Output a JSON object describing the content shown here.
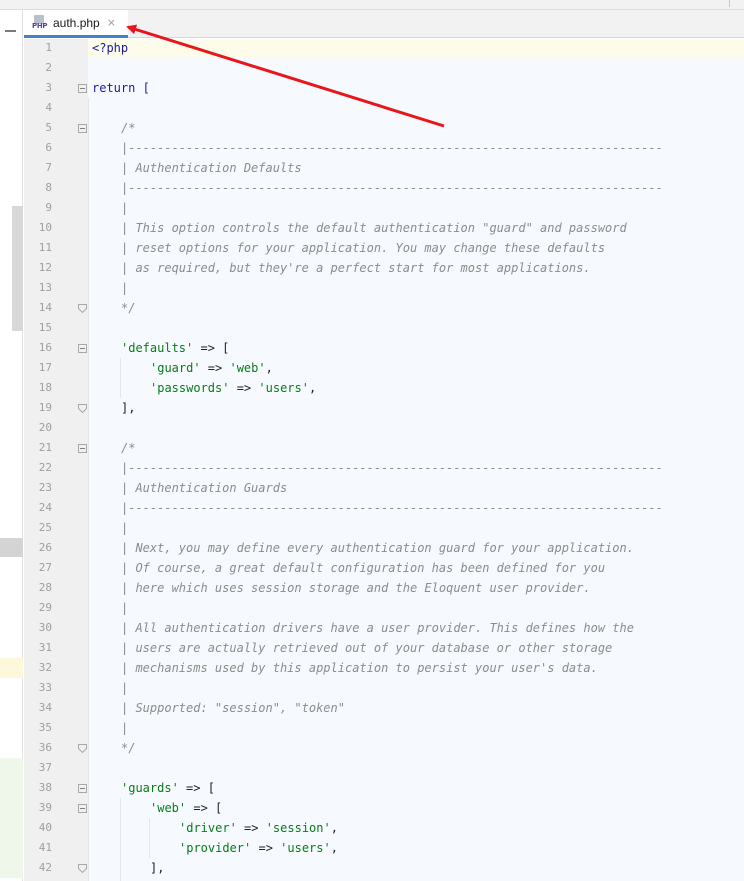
{
  "tab": {
    "filename": "auth.php",
    "icon_label": "PHP",
    "close_glyph": "×",
    "accent": "#4083c9"
  },
  "colors": {
    "keyword": "#1a1aa6",
    "comment": "#8c8c8c",
    "string": "#067d17",
    "annotation_arrow": "#e8161b"
  },
  "code_lines": [
    {
      "n": "1",
      "text": "<?php",
      "kind": "kw",
      "indent": 0,
      "fold": null
    },
    {
      "n": "2",
      "text": "",
      "kind": "plain",
      "indent": 0,
      "fold": null
    },
    {
      "n": "3",
      "text": "return [",
      "kind": "kw",
      "indent": 0,
      "fold": "open"
    },
    {
      "n": "4",
      "text": "",
      "kind": "plain",
      "indent": 0,
      "fold": null
    },
    {
      "n": "5",
      "text": "/*",
      "kind": "com",
      "indent": 1,
      "fold": "open"
    },
    {
      "n": "6",
      "text": "|--------------------------------------------------------------------------",
      "kind": "com",
      "indent": 1,
      "fold": null
    },
    {
      "n": "7",
      "text": "| Authentication Defaults",
      "kind": "com",
      "indent": 1,
      "fold": null
    },
    {
      "n": "8",
      "text": "|--------------------------------------------------------------------------",
      "kind": "com",
      "indent": 1,
      "fold": null
    },
    {
      "n": "9",
      "text": "|",
      "kind": "com",
      "indent": 1,
      "fold": null
    },
    {
      "n": "10",
      "text": "| This option controls the default authentication \"guard\" and password",
      "kind": "com",
      "indent": 1,
      "fold": null
    },
    {
      "n": "11",
      "text": "| reset options for your application. You may change these defaults",
      "kind": "com",
      "indent": 1,
      "fold": null
    },
    {
      "n": "12",
      "text": "| as required, but they're a perfect start for most applications.",
      "kind": "com",
      "indent": 1,
      "fold": null
    },
    {
      "n": "13",
      "text": "|",
      "kind": "com",
      "indent": 1,
      "fold": null
    },
    {
      "n": "14",
      "text": "*/",
      "kind": "com",
      "indent": 1,
      "fold": "close"
    },
    {
      "n": "15",
      "text": "",
      "kind": "plain",
      "indent": 0,
      "fold": null
    },
    {
      "n": "16",
      "text": "'defaults' => [",
      "kind": "arr",
      "indent": 1,
      "fold": "open",
      "key": "'defaults'",
      "rest": " => ["
    },
    {
      "n": "17",
      "text": "'guard' => 'web',",
      "kind": "kv",
      "indent": 2,
      "fold": null,
      "key": "'guard'",
      "val": "'web'"
    },
    {
      "n": "18",
      "text": "'passwords' => 'users',",
      "kind": "kv",
      "indent": 2,
      "fold": null,
      "key": "'passwords'",
      "val": "'users'"
    },
    {
      "n": "19",
      "text": "],",
      "kind": "plain",
      "indent": 1,
      "fold": "close"
    },
    {
      "n": "20",
      "text": "",
      "kind": "plain",
      "indent": 0,
      "fold": null
    },
    {
      "n": "21",
      "text": "/*",
      "kind": "com",
      "indent": 1,
      "fold": "open"
    },
    {
      "n": "22",
      "text": "|--------------------------------------------------------------------------",
      "kind": "com",
      "indent": 1,
      "fold": null
    },
    {
      "n": "23",
      "text": "| Authentication Guards",
      "kind": "com",
      "indent": 1,
      "fold": null
    },
    {
      "n": "24",
      "text": "|--------------------------------------------------------------------------",
      "kind": "com",
      "indent": 1,
      "fold": null
    },
    {
      "n": "25",
      "text": "|",
      "kind": "com",
      "indent": 1,
      "fold": null
    },
    {
      "n": "26",
      "text": "| Next, you may define every authentication guard for your application.",
      "kind": "com",
      "indent": 1,
      "fold": null
    },
    {
      "n": "27",
      "text": "| Of course, a great default configuration has been defined for you",
      "kind": "com",
      "indent": 1,
      "fold": null
    },
    {
      "n": "28",
      "text": "| here which uses session storage and the Eloquent user provider.",
      "kind": "com",
      "indent": 1,
      "fold": null
    },
    {
      "n": "29",
      "text": "|",
      "kind": "com",
      "indent": 1,
      "fold": null
    },
    {
      "n": "30",
      "text": "| All authentication drivers have a user provider. This defines how the",
      "kind": "com",
      "indent": 1,
      "fold": null
    },
    {
      "n": "31",
      "text": "| users are actually retrieved out of your database or other storage",
      "kind": "com",
      "indent": 1,
      "fold": null
    },
    {
      "n": "32",
      "text": "| mechanisms used by this application to persist your user's data.",
      "kind": "com",
      "indent": 1,
      "fold": null
    },
    {
      "n": "33",
      "text": "|",
      "kind": "com",
      "indent": 1,
      "fold": null
    },
    {
      "n": "34",
      "text": "| Supported: \"session\", \"token\"",
      "kind": "com",
      "indent": 1,
      "fold": null
    },
    {
      "n": "35",
      "text": "|",
      "kind": "com",
      "indent": 1,
      "fold": null
    },
    {
      "n": "36",
      "text": "*/",
      "kind": "com",
      "indent": 1,
      "fold": "close"
    },
    {
      "n": "37",
      "text": "",
      "kind": "plain",
      "indent": 0,
      "fold": null
    },
    {
      "n": "38",
      "text": "'guards' => [",
      "kind": "arr",
      "indent": 1,
      "fold": "open",
      "key": "'guards'",
      "rest": " => ["
    },
    {
      "n": "39",
      "text": "'web' => [",
      "kind": "arr",
      "indent": 2,
      "fold": "open",
      "key": "'web'",
      "rest": " => ["
    },
    {
      "n": "40",
      "text": "'driver' => 'session',",
      "kind": "kv",
      "indent": 3,
      "fold": null,
      "key": "'driver'",
      "val": "'session'"
    },
    {
      "n": "41",
      "text": "'provider' => 'users',",
      "kind": "kv",
      "indent": 3,
      "fold": null,
      "key": "'provider'",
      "val": "'users'"
    },
    {
      "n": "42",
      "text": "],",
      "kind": "plain",
      "indent": 2,
      "fold": "close"
    }
  ]
}
